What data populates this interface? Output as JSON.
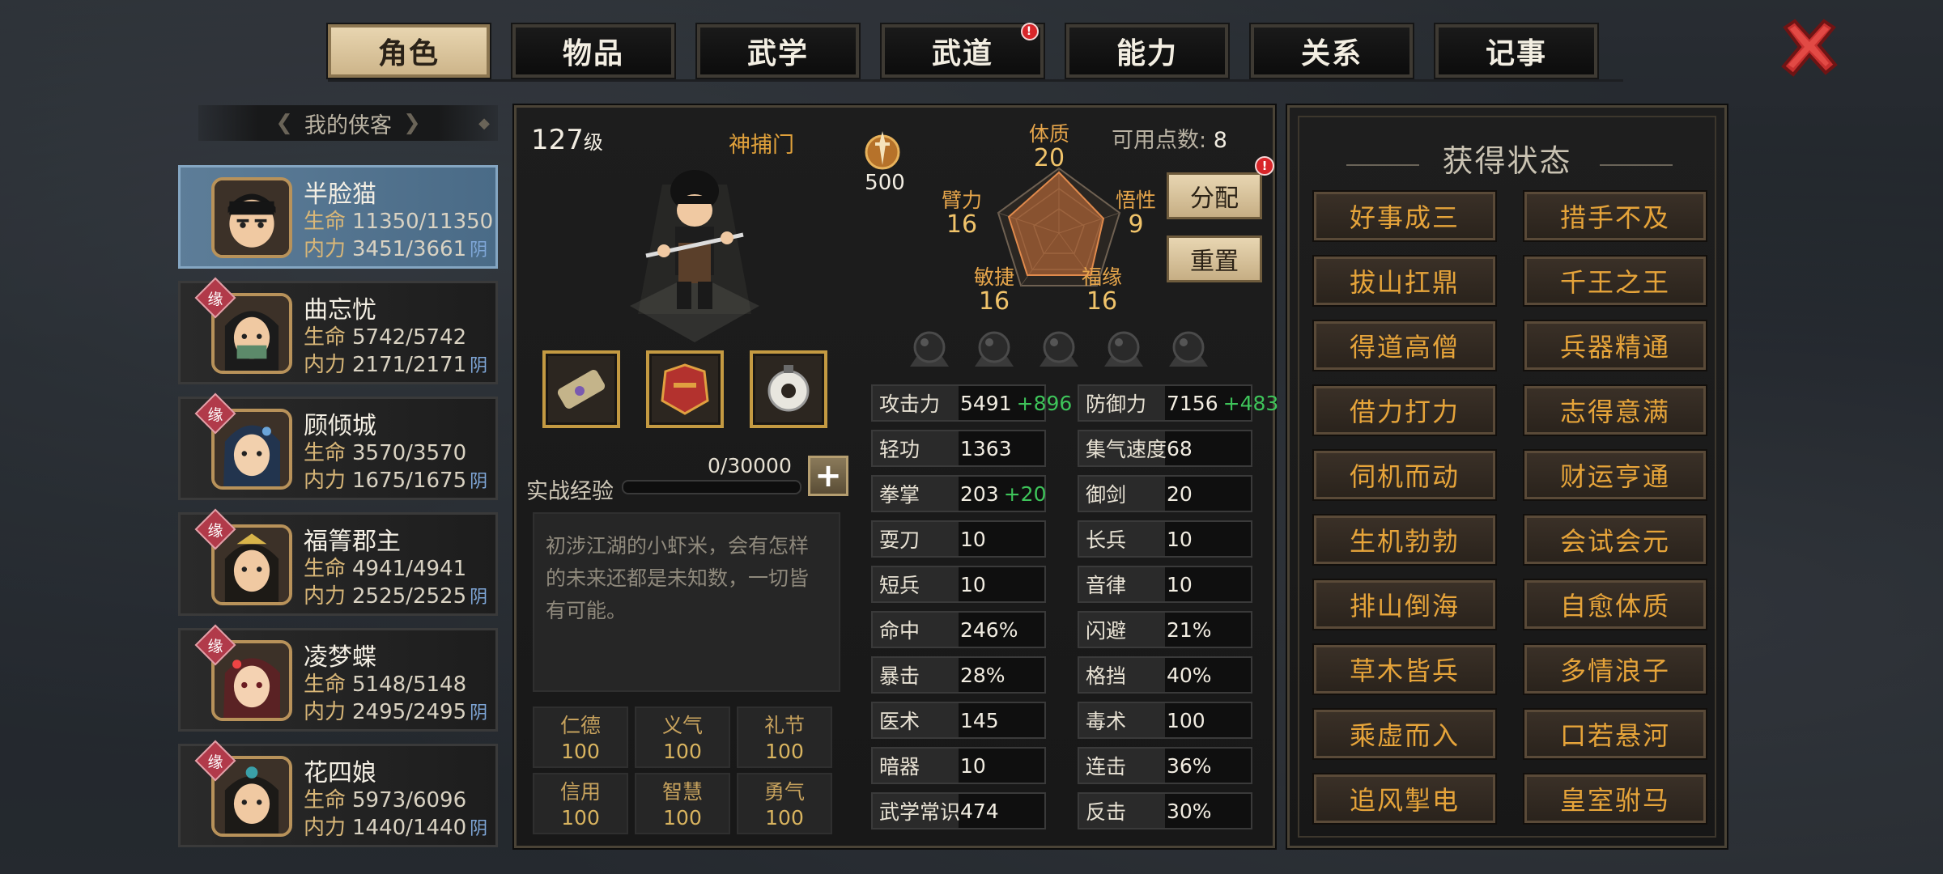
{
  "tabs": [
    {
      "label": "角色",
      "active": true
    },
    {
      "label": "物品"
    },
    {
      "label": "武学"
    },
    {
      "label": "武道",
      "alert": "!"
    },
    {
      "label": "能力"
    },
    {
      "label": "关系"
    },
    {
      "label": "记事"
    }
  ],
  "party": {
    "header": "我的侠客",
    "hp_label": "生命",
    "mp_label": "内力",
    "yin": "阴",
    "badge": "缘",
    "members": [
      {
        "name": "半脸猫",
        "hp": "11350/11350",
        "mp": "3451/3661",
        "active": true
      },
      {
        "name": "曲忘忧",
        "hp": "5742/5742",
        "mp": "2171/2171",
        "badge": true
      },
      {
        "name": "顾倾城",
        "hp": "3570/3570",
        "mp": "1675/1675",
        "badge": true
      },
      {
        "name": "福箐郡主",
        "hp": "4941/4941",
        "mp": "2525/2525",
        "badge": true
      },
      {
        "name": "凌梦蝶",
        "hp": "5148/5148",
        "mp": "2495/2495",
        "badge": true
      },
      {
        "name": "花四娘",
        "hp": "5973/6096",
        "mp": "1440/1440",
        "badge": true
      }
    ]
  },
  "character": {
    "level": "127",
    "level_unit": "级",
    "faction": "神捕门",
    "rank_value": "500",
    "points_label": "可用点数:",
    "points_value": "8",
    "attributes": {
      "tizhi": {
        "label": "体质",
        "value": "20"
      },
      "wuxing": {
        "label": "悟性",
        "value": "9"
      },
      "fuyuan": {
        "label": "福缘",
        "value": "16"
      },
      "minjie": {
        "label": "敏捷",
        "value": "16"
      },
      "bili": {
        "label": "臂力",
        "value": "16"
      }
    },
    "allocate_label": "分配",
    "allocate_alert": "!",
    "reset_label": "重置",
    "exp_label": "实战经验",
    "exp_value": "0/30000",
    "exp_fraction": 0.0,
    "exp_plus": "+",
    "description": "初涉江湖的小虾米，会有怎样的未来还都是未知数，一切皆有可能。",
    "virtues": [
      {
        "label": "仁德",
        "value": "100"
      },
      {
        "label": "义气",
        "value": "100"
      },
      {
        "label": "礼节",
        "value": "100"
      },
      {
        "label": "信用",
        "value": "100"
      },
      {
        "label": "智慧",
        "value": "100"
      },
      {
        "label": "勇气",
        "value": "100"
      }
    ],
    "stats_left": [
      {
        "label": "攻击力",
        "value": "5491",
        "bonus": "+896"
      },
      {
        "label": "轻功",
        "value": "1363",
        "bonus": ""
      },
      {
        "label": "拳掌",
        "value": "203",
        "bonus": "+20"
      },
      {
        "label": "耍刀",
        "value": "10",
        "bonus": ""
      },
      {
        "label": "短兵",
        "value": "10",
        "bonus": ""
      },
      {
        "label": "命中",
        "value": "246%",
        "bonus": ""
      },
      {
        "label": "暴击",
        "value": "28%",
        "bonus": ""
      },
      {
        "label": "医术",
        "value": "145",
        "bonus": ""
      },
      {
        "label": "暗器",
        "value": "10",
        "bonus": ""
      },
      {
        "label": "武学常识",
        "value": "474",
        "bonus": ""
      }
    ],
    "stats_right": [
      {
        "label": "防御力",
        "value": "7156",
        "bonus": "+483"
      },
      {
        "label": "集气速度",
        "value": "68",
        "bonus": ""
      },
      {
        "label": "御剑",
        "value": "20",
        "bonus": ""
      },
      {
        "label": "长兵",
        "value": "10",
        "bonus": ""
      },
      {
        "label": "音律",
        "value": "10",
        "bonus": ""
      },
      {
        "label": "闪避",
        "value": "21%",
        "bonus": ""
      },
      {
        "label": "格挡",
        "value": "40%",
        "bonus": ""
      },
      {
        "label": "毒术",
        "value": "100",
        "bonus": ""
      },
      {
        "label": "连击",
        "value": "36%",
        "bonus": ""
      },
      {
        "label": "反击",
        "value": "30%",
        "bonus": ""
      }
    ]
  },
  "status_panel": {
    "title": "获得状态",
    "items": [
      "好事成三",
      "措手不及",
      "拔山扛鼎",
      "千王之王",
      "得道高僧",
      "兵器精通",
      "借力打力",
      "志得意满",
      "伺机而动",
      "财运亨通",
      "生机勃勃",
      "会试会元",
      "排山倒海",
      "自愈体质",
      "草木皆兵",
      "多情浪子",
      "乘虚而入",
      "口若悬河",
      "追风掣电",
      "皇室驸马"
    ]
  },
  "colors": {
    "accent_gold": "#e6a43a",
    "bonus_green": "#3ec45a",
    "alert_red": "#d8262a",
    "active_blue": "#4a6b87"
  }
}
